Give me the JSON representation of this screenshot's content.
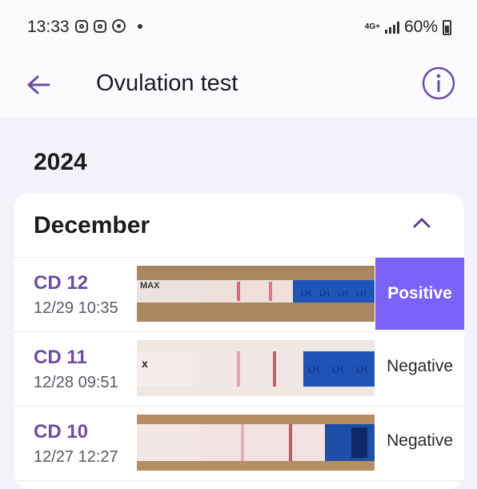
{
  "status": {
    "time": "13:33",
    "network": "4G+",
    "battery": "60%"
  },
  "appbar": {
    "title": "Ovulation test"
  },
  "year": "2024",
  "month": "December",
  "entries": [
    {
      "cd": "CD 12",
      "datetime": "12/29 10:35",
      "result": "Positive",
      "strip_text": [
        "MAX",
        "LH",
        "LH",
        "LH",
        "LH"
      ]
    },
    {
      "cd": "CD 11",
      "datetime": "12/28 09:51",
      "result": "Negative",
      "strip_text": [
        "LH",
        "LH",
        "LH"
      ]
    },
    {
      "cd": "CD 10",
      "datetime": "12/27 12:27",
      "result": "Negative",
      "strip_text": []
    }
  ],
  "colors": {
    "accent": "#6d4ea0",
    "positive_badge": "#7b61f5"
  }
}
